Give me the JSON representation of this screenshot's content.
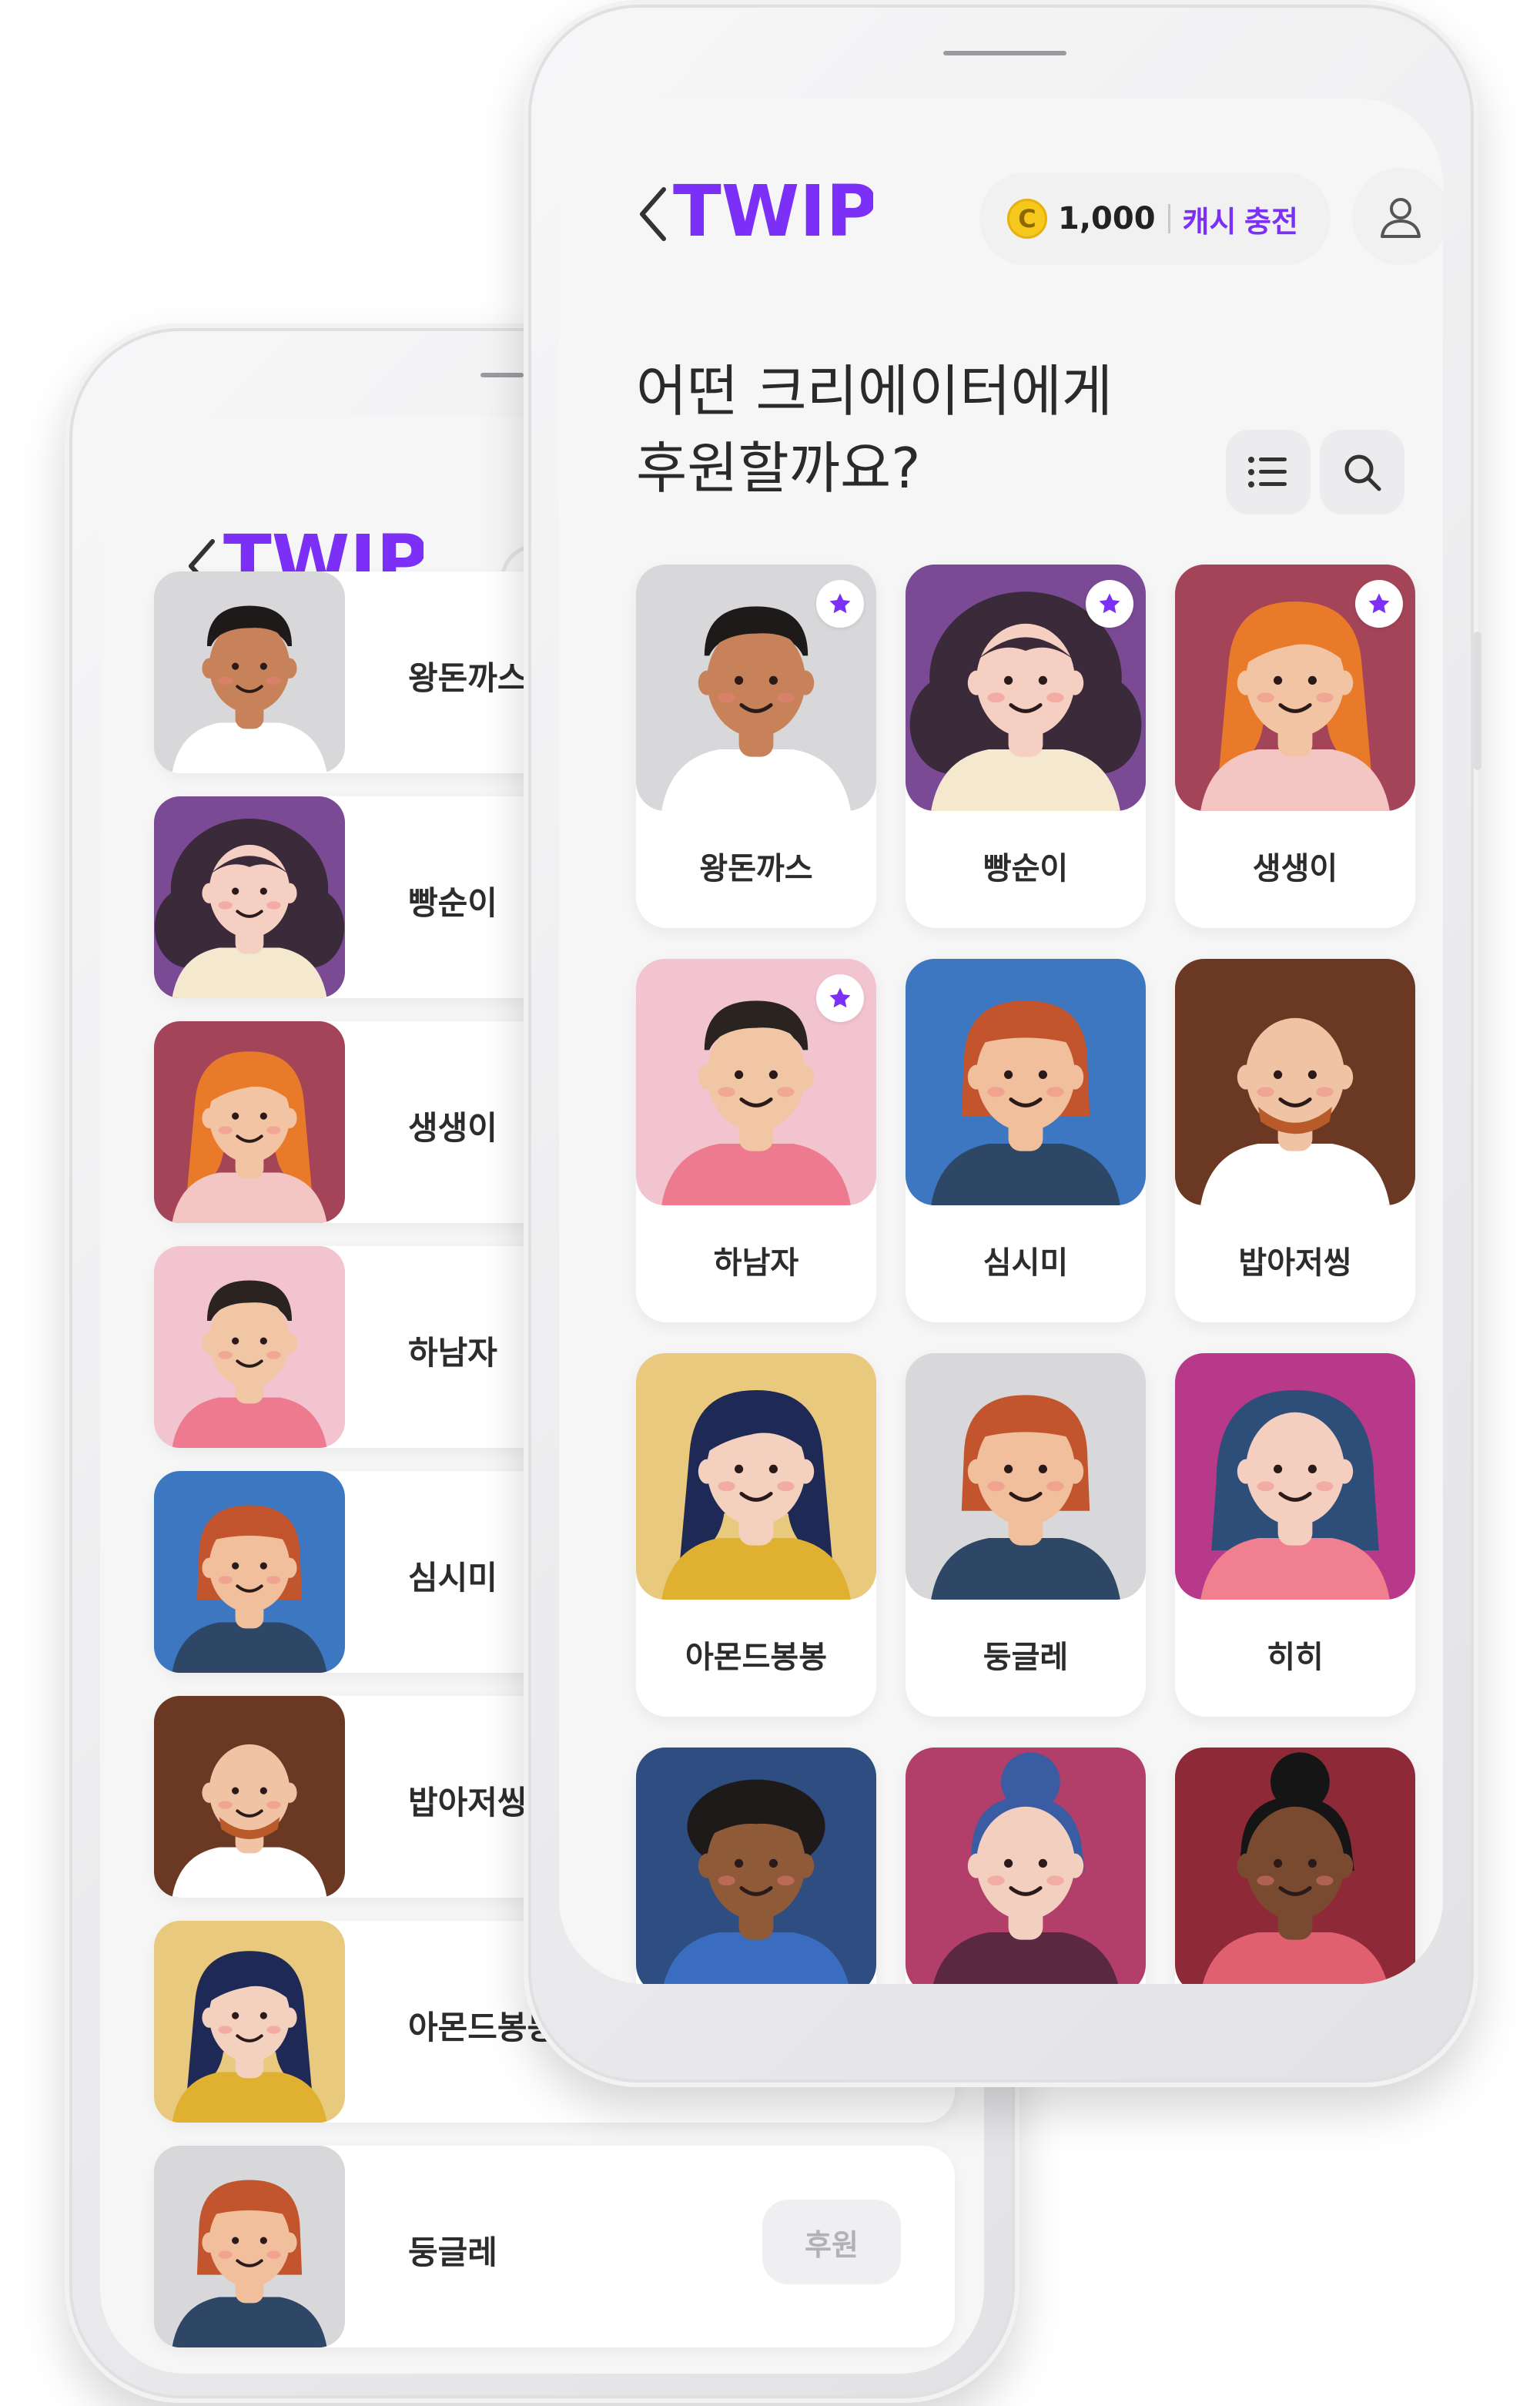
{
  "app": {
    "logo_text": "TWIP",
    "accent_color": "#7b2ff7"
  },
  "front": {
    "cash": {
      "coin_symbol": "C",
      "amount": "1,000",
      "charge_label": "캐시 충전"
    },
    "headline_line1": "어떤 크리에이터에게",
    "headline_line2": "후원할까요?",
    "creators": [
      {
        "name": "왕돈까스",
        "bg": "#d8d8da",
        "skin": "#c8825a",
        "hair": "#1e1a1a",
        "hair_style": "short",
        "shirt": "#ffffff",
        "featured": true
      },
      {
        "name": "빵순이",
        "bg": "#7a4a95",
        "skin": "#f4cfc2",
        "hair": "#3a2a3a",
        "hair_style": "curly",
        "shirt": "#f4e9cf",
        "featured": true
      },
      {
        "name": "생생이",
        "bg": "#a44458",
        "skin": "#f3c4a4",
        "hair": "#e87a2a",
        "hair_style": "long",
        "shirt": "#f3c6c4",
        "featured": true
      },
      {
        "name": "하남자",
        "bg": "#f2c4cf",
        "skin": "#f1c6a4",
        "hair": "#2a2320",
        "hair_style": "short",
        "shirt": "#ee7a90",
        "featured": true
      },
      {
        "name": "심시미",
        "bg": "#3d77c2",
        "skin": "#f1bf9c",
        "hair": "#c2552e",
        "hair_style": "bob",
        "shirt": "#2e4766",
        "featured": false
      },
      {
        "name": "밥아저씽",
        "bg": "#6b3824",
        "skin": "#f0c3a4",
        "hair": "#b85a2a",
        "hair_style": "bald",
        "shirt": "#ffffff",
        "featured": false
      },
      {
        "name": "아몬드봉봉",
        "bg": "#e8c97e",
        "skin": "#f4d0bf",
        "hair": "#1e2a55",
        "hair_style": "long",
        "shirt": "#e0b030",
        "featured": false
      },
      {
        "name": "둥글레",
        "bg": "#d8d8da",
        "skin": "#f1bf9c",
        "hair": "#c2552e",
        "hair_style": "bob",
        "shirt": "#2e4766",
        "featured": false
      },
      {
        "name": "히히",
        "bg": "#b8398a",
        "skin": "#f4cfc0",
        "hair": "#2e4e7a",
        "hair_style": "hijab",
        "shirt": "#f08090",
        "featured": false
      },
      {
        "name": "",
        "bg": "#2e4d80",
        "skin": "#8e5a38",
        "hair": "#1e1a1a",
        "hair_style": "afro",
        "shirt": "#3a6cc0",
        "featured": false
      },
      {
        "name": "",
        "bg": "#b23e6a",
        "skin": "#f3cfc0",
        "hair": "#3a5ca2",
        "hair_style": "bun",
        "shirt": "#5a2840",
        "featured": false
      },
      {
        "name": "",
        "bg": "#8e2a38",
        "skin": "#7a4a30",
        "hair": "#151515",
        "hair_style": "bun",
        "shirt": "#e06070",
        "featured": false
      }
    ]
  },
  "back": {
    "donate_label": "후원",
    "creators": [
      {
        "name": "왕돈까스",
        "bg": "#d8d8da",
        "skin": "#c8825a",
        "hair": "#1e1a1a",
        "hair_style": "short",
        "shirt": "#ffffff",
        "featured": true
      },
      {
        "name": "빵순이",
        "bg": "#7a4a95",
        "skin": "#f4cfc2",
        "hair": "#3a2a3a",
        "hair_style": "curly",
        "shirt": "#f4e9cf",
        "featured": true
      },
      {
        "name": "생생이",
        "bg": "#a44458",
        "skin": "#f3c4a4",
        "hair": "#e87a2a",
        "hair_style": "long",
        "shirt": "#f3c6c4",
        "featured": true
      },
      {
        "name": "하남자",
        "bg": "#f2c4cf",
        "skin": "#f1c6a4",
        "hair": "#2a2320",
        "hair_style": "short",
        "shirt": "#ee7a90",
        "featured": true
      },
      {
        "name": "심시미",
        "bg": "#3d77c2",
        "skin": "#f1bf9c",
        "hair": "#c2552e",
        "hair_style": "bob",
        "shirt": "#2e4766",
        "featured": false
      },
      {
        "name": "밥아저씽",
        "bg": "#6b3824",
        "skin": "#f0c3a4",
        "hair": "#b85a2a",
        "hair_style": "bald",
        "shirt": "#ffffff",
        "featured": false
      },
      {
        "name": "아몬드봉봉",
        "bg": "#e8c97e",
        "skin": "#f4d0bf",
        "hair": "#1e2a55",
        "hair_style": "long",
        "shirt": "#e0b030",
        "featured": false
      },
      {
        "name": "둥글레",
        "bg": "#d8d8da",
        "skin": "#f1bf9c",
        "hair": "#c2552e",
        "hair_style": "bob",
        "shirt": "#2e4766",
        "featured": false
      }
    ]
  }
}
